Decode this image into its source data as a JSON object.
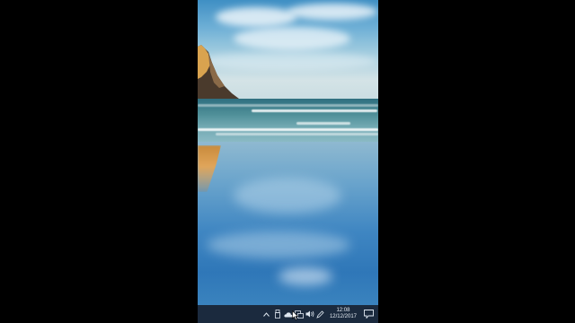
{
  "taskbar": {
    "time": "12:08",
    "date": "12/12/2017",
    "tray_icons": [
      "chevron-up-icon",
      "usb-icon",
      "onedrive-icon",
      "network-icon",
      "volume-icon",
      "pen-icon"
    ],
    "notification_icon": "action-center-icon"
  },
  "colors": {
    "background": "#000000",
    "taskbar": "#1b2a3e",
    "sky": "#6fb0d6",
    "sea": "#2f6f80",
    "beach": "#3f86c2"
  }
}
